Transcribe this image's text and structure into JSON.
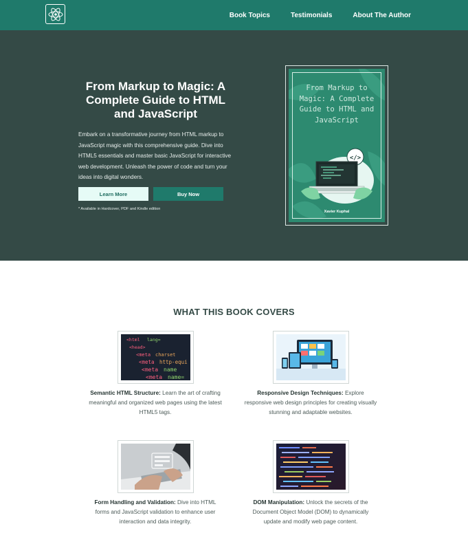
{
  "nav": {
    "links": [
      "Book Topics",
      "Testimonials",
      "About The Author"
    ]
  },
  "hero": {
    "title": "From Markup to Magic: A Complete Guide to HTML and JavaScript",
    "description": "Embark on a transformative journey from HTML markup to JavaScript magic with this comprehensive guide. Dive into HTML5 essentials and master basic JavaScript for interactive web development. Unleash the power of code and turn your ideas into digital wonders.",
    "learn_more": "Learn More",
    "buy_now": "Buy Now",
    "note": "* Available in Hardcover, PDF and Kindle edition"
  },
  "book": {
    "cover_title": "From Markup to Magic: A Complete Guide to HTML and JavaScript",
    "author": "Xavier Kuphal"
  },
  "covers": {
    "title": "WHAT THIS BOOK COVERS",
    "items": [
      {
        "heading": "Semantic HTML Structure:",
        "text": " Learn the art of crafting meaningful and organized web pages using the latest HTML5 tags."
      },
      {
        "heading": "Responsive Design Techniques:",
        "text": " Explore responsive web design principles for creating visually stunning and adaptable websites."
      },
      {
        "heading": "Form Handling and Validation:",
        "text": " Dive into HTML forms and JavaScript validation to enhance user interaction and data integrity."
      },
      {
        "heading": "DOM Manipulation:",
        "text": " Unlock the secrets of the Document Object Model (DOM) to dynamically update and modify web page content."
      }
    ]
  },
  "colors": {
    "nav": "#1f7a6b",
    "hero": "#344a46",
    "accent_light": "#e6fbf6"
  }
}
